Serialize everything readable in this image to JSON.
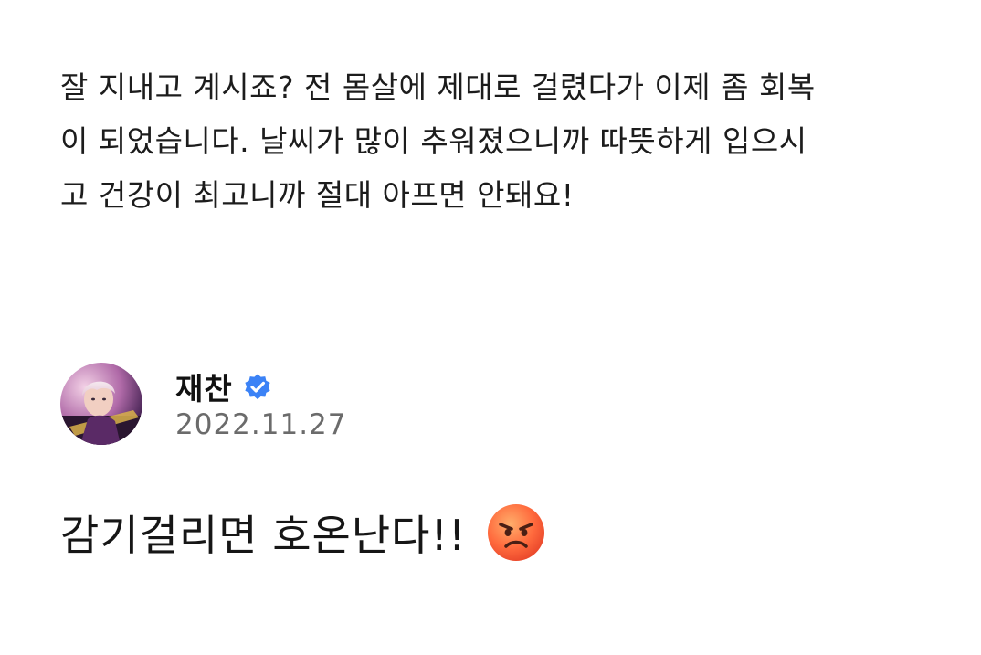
{
  "fan_message": {
    "lines": [
      "잘 지내고 계시죠? 전 몸살에 제대로 걸렸다가 이제 좀 회복",
      "이 되었습니다. 날씨가 많이 추워졌으니까 따뜻하게 입으시",
      "고 건강이 최고니까 절대 아프면 안돼요!"
    ]
  },
  "reply": {
    "author_name": "재찬",
    "verified_icon": "verified-badge-icon",
    "avatar_icon": "profile-photo",
    "timestamp": "2022.11.27",
    "message": "감기걸리면 호온난다!!",
    "emoji": "angry-face-emoji"
  },
  "colors": {
    "verified_badge": "#3b82f6",
    "timestamp": "#6b6b6b",
    "emoji_fill": "#ff6a3d"
  }
}
